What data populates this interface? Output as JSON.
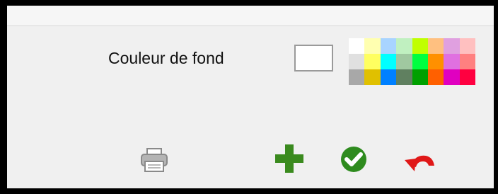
{
  "background_color": {
    "label": "Couleur de fond",
    "selected_color": "#ffffff"
  },
  "palette": {
    "colors": [
      "#ffffff",
      "#ffffb0",
      "#a8d4ff",
      "#c0f0c0",
      "#c0ff00",
      "#ffc080",
      "#e0a0e0",
      "#ffc0c0",
      "#e0e0e0",
      "#ffff60",
      "#00ffff",
      "#a0c8a0",
      "#00ff40",
      "#ff9000",
      "#e070e0",
      "#ff8080",
      "#a8a8a8",
      "#e0c000",
      "#0080ff",
      "#608060",
      "#00a000",
      "#ff6000",
      "#e000c0",
      "#ff0040"
    ]
  },
  "toolbar": {
    "icons": [
      "printer-icon",
      "plus-icon",
      "checkmark-icon",
      "undo-icon"
    ],
    "colors": {
      "add": "#3a8a1e",
      "ok": "#2e8b1e",
      "undo": "#e01818",
      "print": "#9a9a9a"
    }
  }
}
